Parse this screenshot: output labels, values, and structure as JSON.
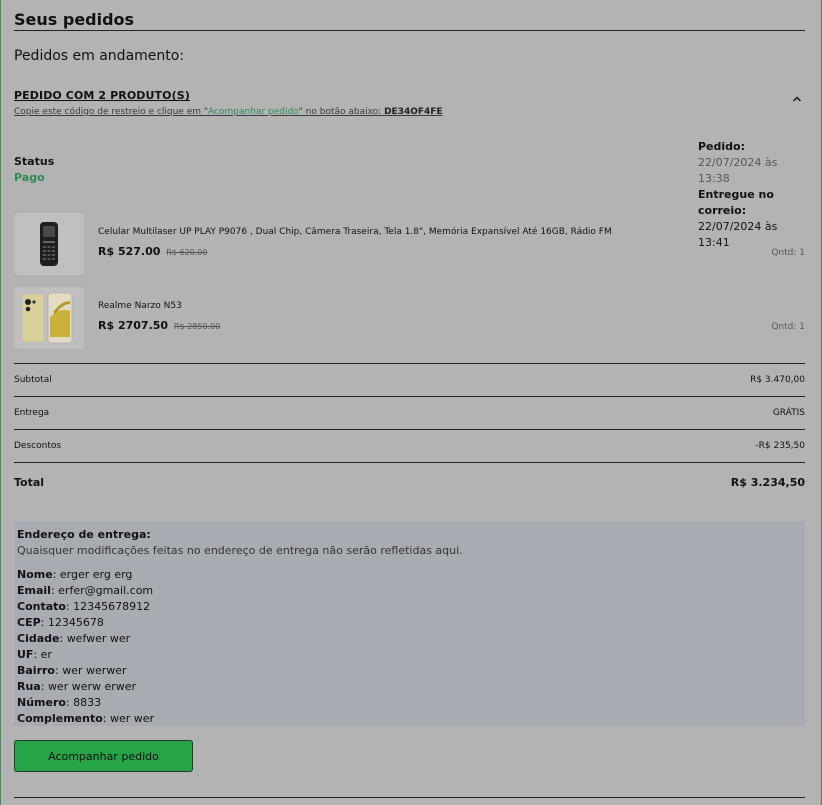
{
  "page": {
    "title": "Seus pedidos",
    "section_heading": "Pedidos em andamento:"
  },
  "order": {
    "title": "PEDIDO COM 2 PRODUTO(S)",
    "hint_prefix": "Copie este código de restreio e clique em \"",
    "hint_link": "Acompanhar pedido",
    "hint_middle": "\" no botão abaixo: ",
    "tracking_code": "DE34OF4FE",
    "collapse_icon": "chevron-up-icon",
    "status_label": "Status",
    "status_value": "Pago",
    "status_color": "#2e8b57",
    "ordered_label": "Pedido:",
    "ordered_at": "22/07/2024 às 13:38",
    "shipped_label": "Entregue no correio:",
    "shipped_at": "22/07/2024 às 13:41"
  },
  "products": [
    {
      "name": "Celular Multilaser UP PLAY P9076 , Dual Chip, Câmera Traseira, Tela 1.8\", Memória Expansível Até 16GB, Rádio FM",
      "price": "R$ 527.00",
      "old_price": "R$ 620.00",
      "qty": "Qntd: 1"
    },
    {
      "name": "Realme Narzo N53",
      "price": "R$ 2707.50",
      "old_price": "R$ 2850.00",
      "qty": "Qntd: 1"
    }
  ],
  "totals": {
    "subtotal_label": "Subtotal",
    "subtotal": "R$ 3.470,00",
    "shipping_label": "Entrega",
    "shipping": "GRÁTIS",
    "discount_label": "Descontos",
    "discount": "-R$ 235,50",
    "total_label": "Total",
    "total": "R$ 3.234,50"
  },
  "address": {
    "heading": "Endereço de entrega:",
    "note": "Quaisquer modificações feitas no endereço de entrega não serão refletidas aqui.",
    "fields": [
      {
        "label": "Nome",
        "value": "erger erg erg"
      },
      {
        "label": "Email",
        "value": "erfer@gmail.com"
      },
      {
        "label": "Contato",
        "value": "12345678912"
      },
      {
        "label": "CEP",
        "value": "12345678"
      },
      {
        "label": "Cidade",
        "value": "wefwer wer"
      },
      {
        "label": "UF",
        "value": "er"
      },
      {
        "label": "Bairro",
        "value": "wer werwer"
      },
      {
        "label": "Rua",
        "value": "wer werw erwer"
      },
      {
        "label": "Número",
        "value": "8833"
      },
      {
        "label": "Complemento",
        "value": "wer wer"
      }
    ]
  },
  "actions": {
    "track_label": "Acompanhar pedido",
    "accent": "#27a348"
  }
}
